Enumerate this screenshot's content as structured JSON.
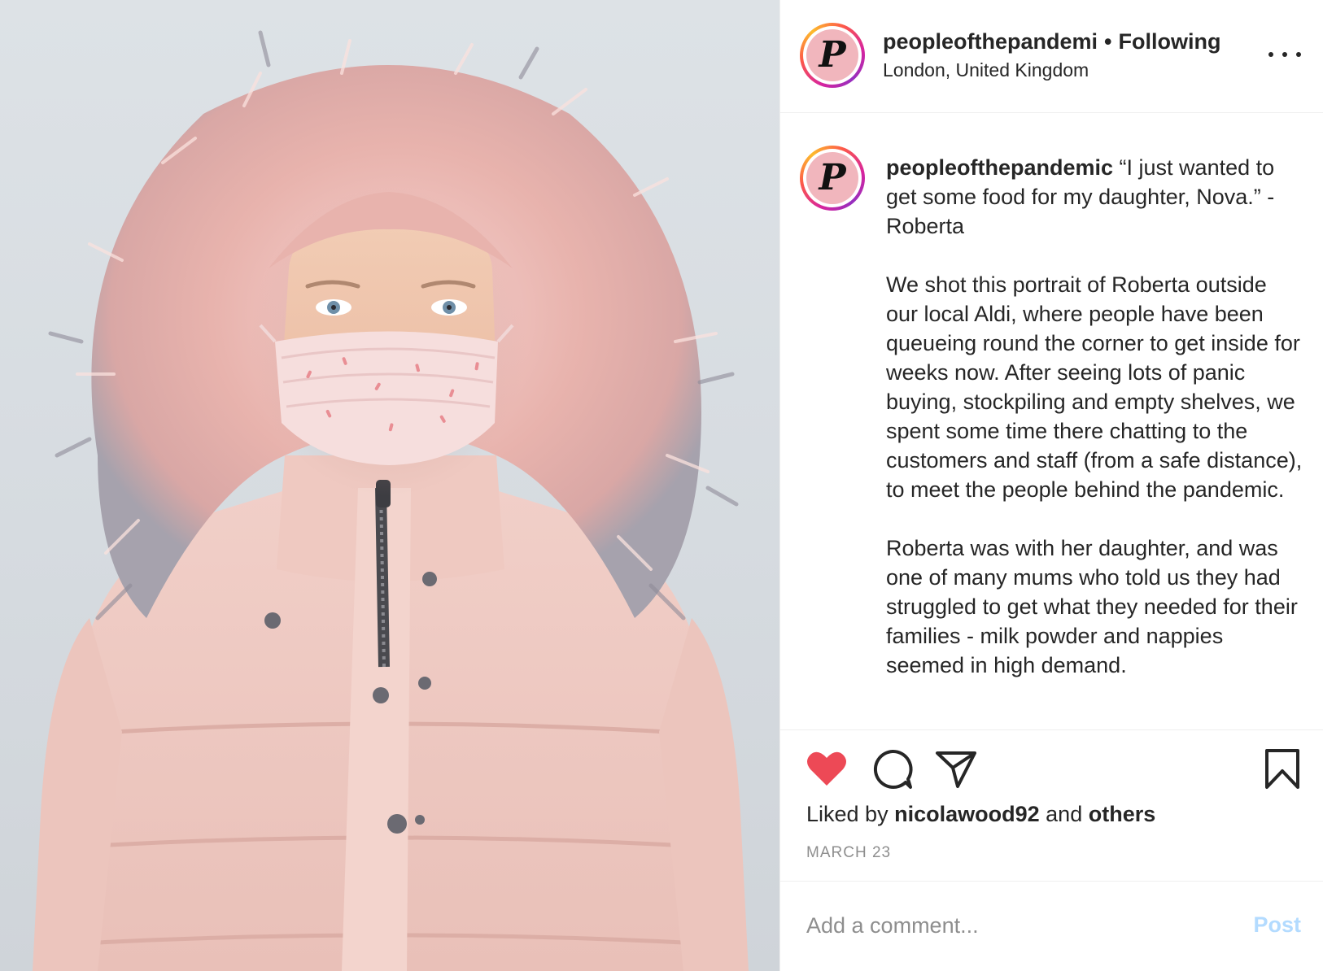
{
  "photo": {
    "description_icon": "portrait-photo"
  },
  "header": {
    "username": "peopleofthepandemi",
    "separator": "•",
    "follow_status": "Following",
    "location": "London, United Kingdom",
    "avatar_letter": "P",
    "more_icon": "more-options-icon"
  },
  "caption": {
    "avatar_letter": "P",
    "username": "peopleofthepandemic",
    "paragraph1": "“I just wanted to get some food for my daughter, Nova.” - Roberta",
    "paragraph2": "We shot this portrait of Roberta outside our local Aldi, where people have been queueing round the corner to get inside for weeks now. After seeing lots of panic buying, stockpiling and empty shelves, we spent some time there chatting to the customers and staff (from a safe distance), to meet the people behind the pandemic.",
    "paragraph3": "Roberta was with her daughter, and was one of many mums who told us they had struggled to get what they needed for their families - milk powder and nappies seemed in high demand."
  },
  "actions": {
    "liked": true,
    "like_color": "#ed4956",
    "icons": [
      "heart-icon",
      "comment-icon",
      "share-icon",
      "bookmark-icon"
    ],
    "likes_prefix": "Liked by",
    "likes_user": "nicolawood92",
    "likes_and": "and",
    "likes_others": "others",
    "date": "MARCH 23"
  },
  "comment": {
    "placeholder": "Add a comment...",
    "post_label": "Post",
    "post_color": "#b3dbff"
  }
}
